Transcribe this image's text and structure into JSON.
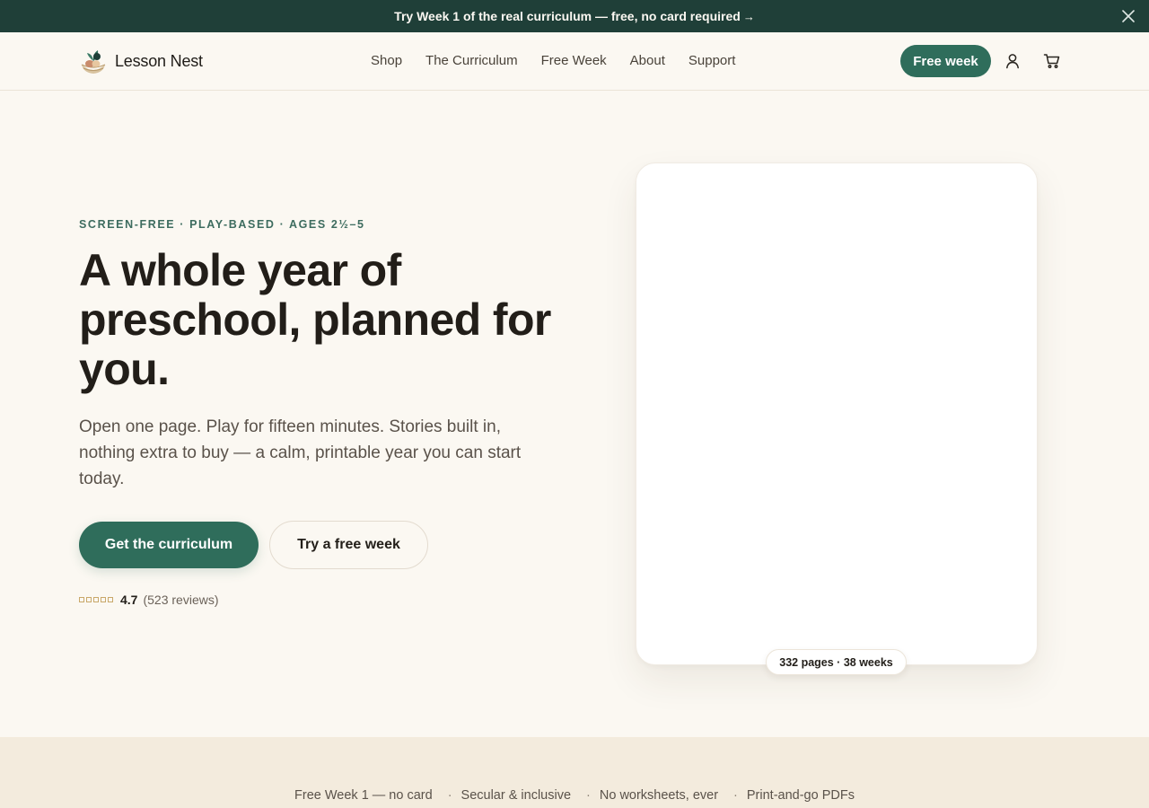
{
  "announcement": {
    "text": "Try Week 1 of the real curriculum — free, no card required",
    "arrow": "→",
    "close_icon": "close-icon"
  },
  "header": {
    "brand": "Lesson Nest",
    "logo_icon": "nest-logo",
    "nav": [
      "Shop",
      "The Curriculum",
      "Free Week",
      "About",
      "Support"
    ],
    "cta": "Free week",
    "account_icon": "user-icon",
    "cart_icon": "cart-icon"
  },
  "hero": {
    "eyebrow": "SCREEN-FREE · PLAY-BASED · AGES 2½–5",
    "headline": "A whole year of preschool, planned for you.",
    "lede": "Open one page. Play for fifteen minutes. Stories built in, nothing extra to buy — a calm, printable year you can start today.",
    "primary_cta": "Get the curriculum",
    "secondary_cta": "Try a free week",
    "rating": {
      "stars": 5,
      "score": "4.7",
      "reviews": "(523 reviews)"
    }
  },
  "product_card": {
    "badge": "332 pages · 38 weeks"
  },
  "trust": [
    "Free Week 1 — no card",
    "Secular & inclusive",
    "No worksheets, ever",
    "Print-and-go PDFs"
  ],
  "colors": {
    "accent": "#2f6d5b",
    "announcement_bg": "#1f3f38",
    "page_bg": "#fbf8f2",
    "band_bg": "#f3ebdd",
    "eyebrow": "#3d6c5f"
  }
}
